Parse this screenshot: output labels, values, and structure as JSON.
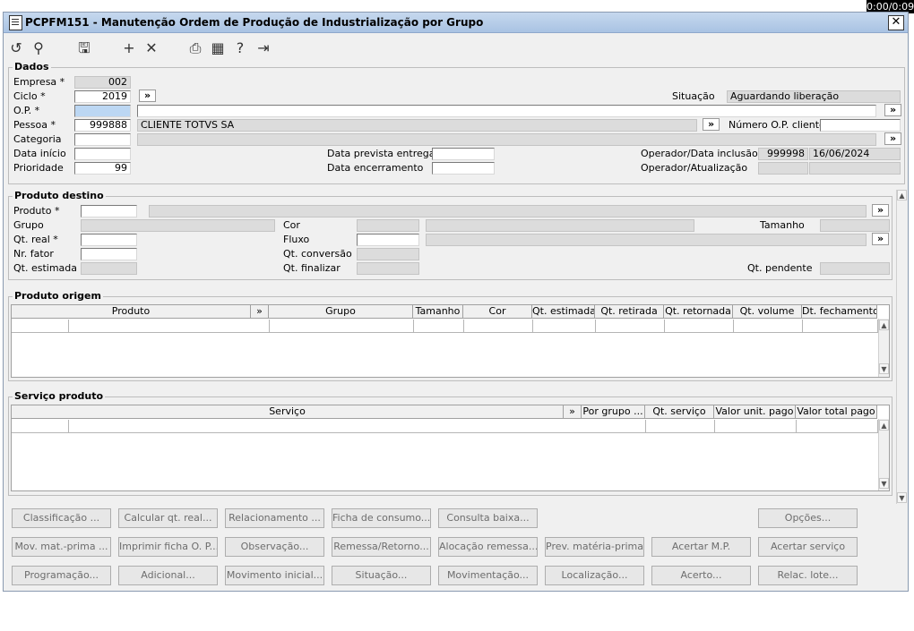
{
  "window": {
    "title": "PCPFM151 - Manutenção Ordem de Produção de Industrialização por Grupo",
    "timer": "0:00/0:09"
  },
  "toolbar": {
    "icons": [
      "undo-icon",
      "search-icon",
      "save-icon",
      "add-icon",
      "delete-icon",
      "print-icon",
      "calendar-icon",
      "help-icon",
      "exit-icon"
    ]
  },
  "dados": {
    "legend": "Dados",
    "empresa_label": "Empresa *",
    "empresa": "002",
    "ciclo_label": "Ciclo *",
    "ciclo": "2019",
    "op_label": "O.P. *",
    "op": "",
    "pessoa_label": "Pessoa *",
    "pessoa_code": "999888",
    "pessoa_name": "CLIENTE TOTVS SA",
    "categoria_label": "Categoria",
    "data_inicio_label": "Data início",
    "prioridade_label": "Prioridade",
    "prioridade": "99",
    "situacao_label": "Situação",
    "situacao": "Aguardando liberação",
    "numero_op_cliente_label": "Número O.P. cliente",
    "data_prevista_label": "Data prevista entrega",
    "data_encerramento_label": "Data encerramento",
    "operador_inclusao_label": "Operador/Data inclusão",
    "operador_code": "999998",
    "data_inclusao": "16/06/2024",
    "operador_atualizacao_label": "Operador/Atualização"
  },
  "destino": {
    "legend": "Produto destino",
    "produto_label": "Produto *",
    "grupo_label": "Grupo",
    "qt_real_label": "Qt. real *",
    "nr_fator_label": "Nr. fator",
    "qt_estimada_label": "Qt. estimada",
    "cor_label": "Cor",
    "fluxo_label": "Fluxo",
    "qt_conversao_label": "Qt. conversão",
    "qt_finalizar_label": "Qt. finalizar",
    "tamanho_label": "Tamanho",
    "qt_pendente_label": "Qt. pendente"
  },
  "origem": {
    "legend": "Produto origem",
    "columns": [
      "Produto",
      "»",
      "Grupo",
      "Tamanho",
      "Cor",
      "Qt. estimada",
      "Qt. retirada",
      "Qt. retornada",
      "Qt. volume",
      "Dt. fechamento"
    ]
  },
  "servico": {
    "legend": "Serviço produto",
    "columns": [
      "Serviço",
      "»",
      "Por grupo ...",
      "Qt. serviço",
      "Valor unit. pago",
      "Valor total pago"
    ]
  },
  "lookup": "»",
  "buttons": [
    [
      "Classificação ...",
      "Calcular qt. real...",
      "Relacionamento ...",
      "Ficha de consumo...",
      "Consulta baixa...",
      "",
      "",
      "Opções..."
    ],
    [
      "Mov. mat.-prima ...",
      "Imprimir ficha O. P...",
      "Observação...",
      "Remessa/Retorno...",
      "Alocação remessa...",
      "Prev. matéria-prima...",
      "Acertar M.P.",
      "Acertar serviço"
    ],
    [
      "Programação...",
      "Adicional...",
      "Movimento inicial...",
      "Situação...",
      "Movimentação...",
      "Localização...",
      "Acerto...",
      "Relac. lote..."
    ]
  ]
}
